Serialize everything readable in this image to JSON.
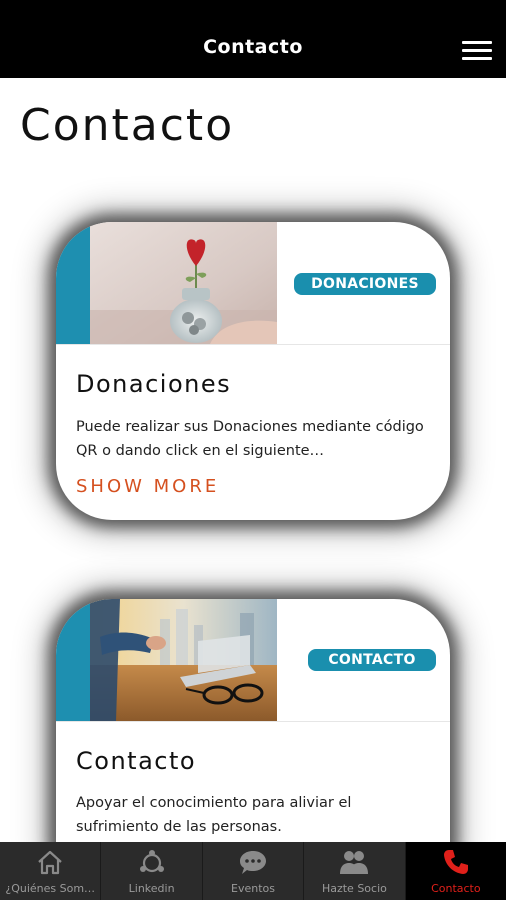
{
  "header": {
    "title": "Contacto"
  },
  "page": {
    "title": "Contacto"
  },
  "cards": [
    {
      "badge": "DONACIONES",
      "heading": "Donaciones",
      "body": "Puede realizar sus Donaciones mediante código QR o dando click en el siguiente…",
      "action": "SHOW MORE",
      "image_icon": "heart-plant-jar-photo"
    },
    {
      "badge": "CONTACTO",
      "heading": "Contacto",
      "body": "Apoyar el conocimiento para aliviar el sufrimiento de las personas.",
      "image_icon": "desk-laptop-glasses-photo"
    }
  ],
  "tabs": [
    {
      "label": "¿Quiénes Som…",
      "icon": "home-icon"
    },
    {
      "label": "Linkedin",
      "icon": "network-icon"
    },
    {
      "label": "Eventos",
      "icon": "chat-bubble-icon"
    },
    {
      "label": "Hazte Socio",
      "icon": "people-icon"
    },
    {
      "label": "Contacto",
      "icon": "phone-icon",
      "active": true
    }
  ],
  "colors": {
    "accent_blue": "#1a8fae",
    "show_more": "#d5501f",
    "active_tab": "#e0201a",
    "tabbar_bg": "#2b2b2b"
  }
}
